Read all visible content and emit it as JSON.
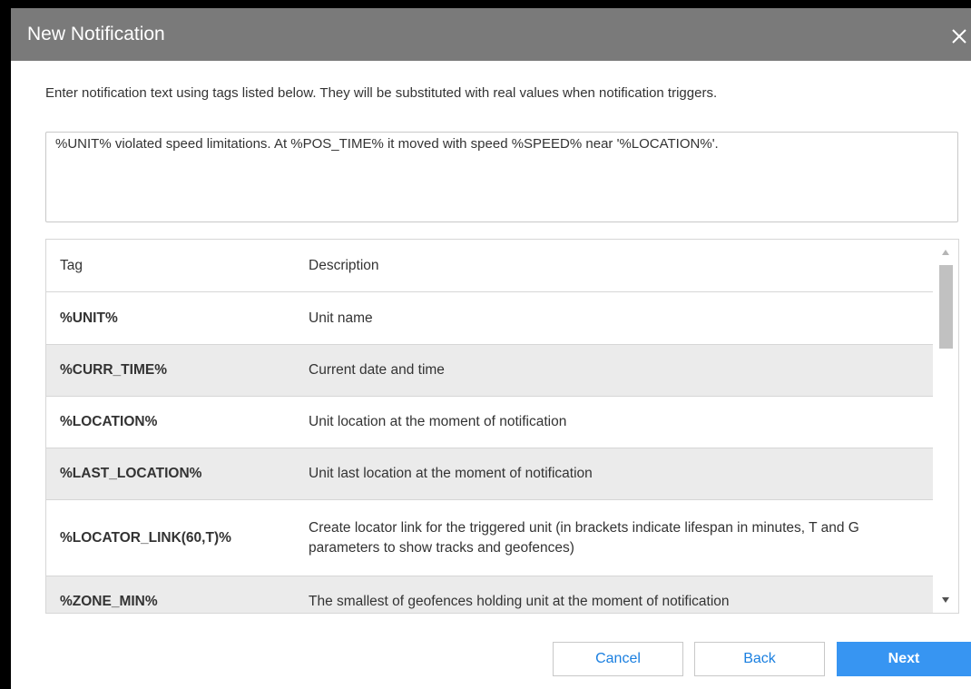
{
  "dialog": {
    "title": "New Notification",
    "close_icon": "close-icon"
  },
  "instructions": "Enter notification text using tags listed below. They will be substituted with real values when notification triggers.",
  "notification_text": "%UNIT% violated speed limitations. At %POS_TIME% it moved with speed %SPEED% near '%LOCATION%'.",
  "table": {
    "columns": [
      "Tag",
      "Description"
    ],
    "rows": [
      {
        "tag": "%UNIT%",
        "description": "Unit name"
      },
      {
        "tag": "%CURR_TIME%",
        "description": "Current date and time"
      },
      {
        "tag": "%LOCATION%",
        "description": "Unit location at the moment of notification"
      },
      {
        "tag": "%LAST_LOCATION%",
        "description": "Unit last location at the moment of notification"
      },
      {
        "tag": "%LOCATOR_LINK(60,T)%",
        "description": "Create locator link for the triggered unit (in brackets indicate lifespan in minutes, T and G parameters to show tracks and geofences)"
      },
      {
        "tag": "%ZONE_MIN%",
        "description": "The smallest of geofences holding unit at the moment of notification"
      }
    ]
  },
  "buttons": {
    "cancel": "Cancel",
    "back": "Back",
    "next": "Next"
  },
  "colors": {
    "titlebar": "#7a7a7a",
    "primary": "#3795f2",
    "link": "#1a7fe0",
    "row_alt": "#ebebeb"
  }
}
